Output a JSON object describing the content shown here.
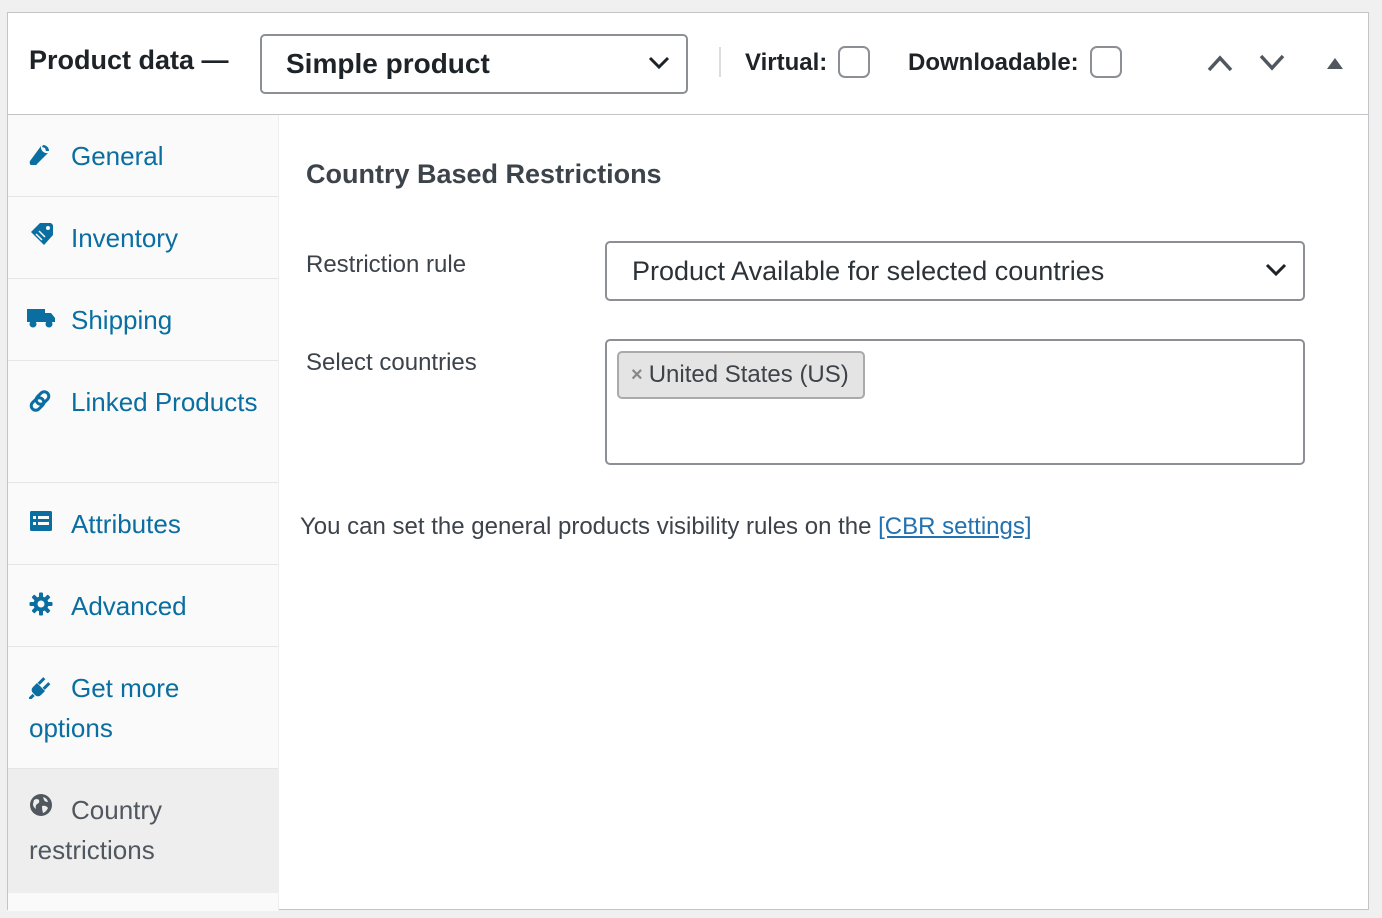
{
  "header": {
    "title": "Product data —",
    "product_type": "Simple product",
    "virtual_label": "Virtual:",
    "downloadable_label": "Downloadable:",
    "virtual_checked": false,
    "downloadable_checked": false
  },
  "tabs": [
    {
      "label": "General",
      "icon": "wrench-icon"
    },
    {
      "label": "Inventory",
      "icon": "tag-icon"
    },
    {
      "label": "Shipping",
      "icon": "truck-icon"
    },
    {
      "label": "Linked Products",
      "icon": "link-icon"
    },
    {
      "label": "Attributes",
      "icon": "list-icon"
    },
    {
      "label": "Advanced",
      "icon": "gear-icon"
    },
    {
      "label": "Get more options",
      "icon": "plug-icon"
    },
    {
      "label": "Country restrictions",
      "icon": "globe-icon",
      "active": true
    }
  ],
  "content": {
    "section_title": "Country Based Restrictions",
    "restriction_rule_label": "Restriction rule",
    "restriction_rule_value": "Product Available for selected countries",
    "select_countries_label": "Select countries",
    "selected_countries": [
      "United States (US)"
    ],
    "chip_remove": "×",
    "note_text": "You can set the general products visibility rules on the ",
    "note_link": "[CBR settings]"
  },
  "colors": {
    "link": "#0a6ea1",
    "active_tab_bg": "#eeeeee",
    "border": "#8c8f94"
  }
}
